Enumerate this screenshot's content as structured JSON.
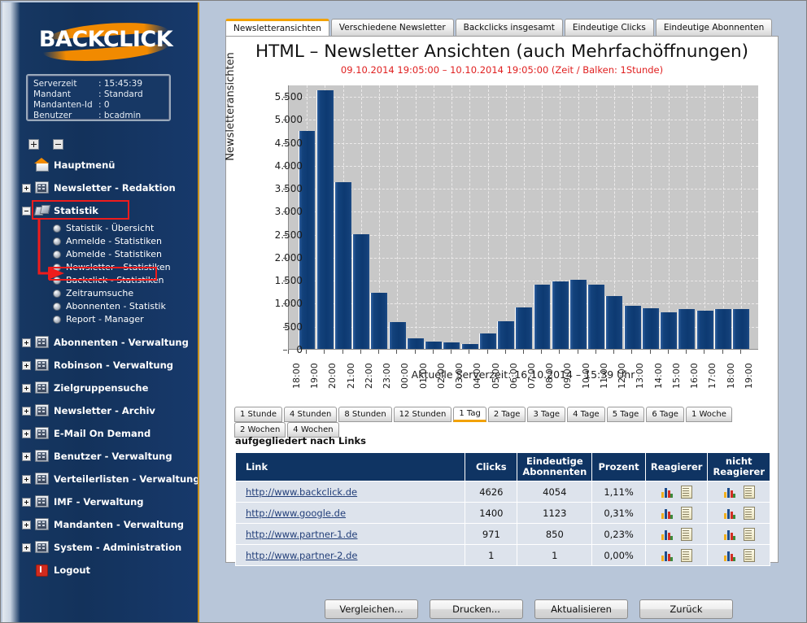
{
  "brand": {
    "name": "BACKCLICK"
  },
  "info": {
    "rows": [
      {
        "key": "Serverzeit",
        "sep": ": 15:45:39"
      },
      {
        "key": "Mandant",
        "sep": ": Standard"
      },
      {
        "key": "Mandanten-Id",
        "sep": ": 0"
      },
      {
        "key": "Benutzer",
        "sep": ": bcadmin"
      }
    ]
  },
  "tree_buttons": {
    "expand_all": "+",
    "collapse_all": "-"
  },
  "sidebar": {
    "items": [
      {
        "label": "Hauptmenü",
        "icon": "home-icon",
        "expandable": false
      },
      {
        "label": "Newsletter - Redaktion",
        "icon": "folder-icon",
        "expandable": true,
        "expanded": false
      },
      {
        "label": "Statistik",
        "icon": "statistics-icon",
        "expandable": true,
        "expanded": true,
        "highlighted": true
      },
      {
        "label": "Abonnenten - Verwaltung",
        "icon": "folder-icon",
        "expandable": true,
        "expanded": false
      },
      {
        "label": "Robinson - Verwaltung",
        "icon": "folder-icon",
        "expandable": true,
        "expanded": false
      },
      {
        "label": "Zielgruppensuche",
        "icon": "folder-icon",
        "expandable": true,
        "expanded": false
      },
      {
        "label": "Newsletter - Archiv",
        "icon": "folder-icon",
        "expandable": true,
        "expanded": false
      },
      {
        "label": "E-Mail On Demand",
        "icon": "folder-icon",
        "expandable": true,
        "expanded": false
      },
      {
        "label": "Benutzer - Verwaltung",
        "icon": "folder-icon",
        "expandable": true,
        "expanded": false
      },
      {
        "label": "Verteilerlisten - Verwaltung",
        "icon": "folder-icon",
        "expandable": true,
        "expanded": false
      },
      {
        "label": "IMF - Verwaltung",
        "icon": "folder-icon",
        "expandable": true,
        "expanded": false
      },
      {
        "label": "Mandanten - Verwaltung",
        "icon": "folder-icon",
        "expandable": true,
        "expanded": false
      },
      {
        "label": "System - Administration",
        "icon": "folder-icon",
        "expandable": true,
        "expanded": false
      },
      {
        "label": "Logout",
        "icon": "logout-icon",
        "expandable": false
      }
    ],
    "statistik_children": [
      "Statistik - Übersicht",
      "Anmelde - Statistiken",
      "Abmelde - Statistiken",
      "Newsletter - Statistiken",
      "Backclick - Statistiken",
      "Zeitraumsuche",
      "Abonnenten - Statistik",
      "Report - Manager"
    ],
    "selected_child": "Backclick - Statistiken"
  },
  "annotations": {
    "highlight_color": "#ee1c1c",
    "boxed_items": [
      "Statistik",
      "Backclick - Statistiken"
    ],
    "arrow": "points from Statistik node down to Backclick - Statistiken"
  },
  "tabs": [
    {
      "label": "Newsletteransichten",
      "active": true
    },
    {
      "label": "Verschiedene Newsletter",
      "active": false
    },
    {
      "label": "Backclicks insgesamt",
      "active": false
    },
    {
      "label": "Eindeutige Clicks",
      "active": false
    },
    {
      "label": "Eindeutige Abonnenten",
      "active": false
    }
  ],
  "chart_data": {
    "type": "bar",
    "title": "HTML – Newsletter Ansichten (auch Mehrfachöffnungen)",
    "subtitle": "09.10.2014 19:05:00 – 10.10.2014 19:05:00  (Zeit / Balken: 1Stunde)",
    "xlabel": "",
    "ylabel": "Newsletteransichten",
    "ylim": [
      0,
      5750
    ],
    "yticks": [
      0,
      500,
      1000,
      1500,
      2000,
      2500,
      3000,
      3500,
      4000,
      4500,
      5000,
      5500
    ],
    "ytick_labels": [
      "0",
      "500",
      "1.000",
      "1.500",
      "2.000",
      "2.500",
      "3.000",
      "3.500",
      "4.000",
      "4.500",
      "5.000",
      "5.500"
    ],
    "categories": [
      "18:00",
      "19:00",
      "20:00",
      "21:00",
      "22:00",
      "23:00",
      "00:00",
      "01:00",
      "02:00",
      "03:00",
      "04:00",
      "05:00",
      "06:00",
      "07:00",
      "08:00",
      "09:00",
      "10:00",
      "11:00",
      "12:00",
      "13:00",
      "14:00",
      "15:00",
      "16:00",
      "17:00",
      "18:00",
      "19:00"
    ],
    "bar_labels": [
      "19:00",
      "20:00",
      "21:00",
      "22:00",
      "23:00",
      "00:00",
      "01:00",
      "02:00",
      "03:00",
      "04:00",
      "05:00",
      "06:00",
      "07:00",
      "08:00",
      "09:00",
      "10:00",
      "11:00",
      "12:00",
      "13:00",
      "14:00",
      "15:00",
      "16:00",
      "17:00",
      "18:00",
      "19:00"
    ],
    "values": [
      4750,
      5620,
      3620,
      2500,
      1220,
      590,
      230,
      160,
      140,
      110,
      330,
      600,
      900,
      1400,
      1470,
      1500,
      1400,
      1150,
      930,
      890,
      800,
      860,
      840,
      870,
      870
    ],
    "grid": true,
    "legend": false,
    "bar_color": "#123f78",
    "plot_background": "#c8c8c8",
    "footer": "Aktuelle Serverzeit: 16.10.2014 – 15:39 Uhr"
  },
  "timerange": {
    "options": [
      "1 Stunde",
      "4 Stunden",
      "8 Stunden",
      "12 Stunden",
      "1 Tag",
      "2 Tage",
      "3 Tage",
      "4 Tage",
      "5 Tage",
      "6 Tage",
      "1 Woche",
      "2 Wochen",
      "4 Wochen"
    ],
    "selected": "1 Tag"
  },
  "table": {
    "caption": "aufgegliedert nach Links",
    "headers": [
      "Link",
      "Clicks",
      "Eindeutige Abonnenten",
      "Prozent",
      "Reagierer",
      "nicht Reagierer"
    ],
    "headers_split": {
      "eindeutige_abonnenten": [
        "Eindeutige",
        "Abonnenten"
      ],
      "nicht_reagierer": [
        "nicht",
        "Reagierer"
      ]
    },
    "rows": [
      {
        "link": "http://www.backclick.de",
        "clicks": "4626",
        "unique": "4054",
        "percent": "1,11%"
      },
      {
        "link": "http://www.google.de",
        "clicks": "1400",
        "unique": "1123",
        "percent": "0,31%"
      },
      {
        "link": "http://www.partner-1.de",
        "clicks": "971",
        "unique": "850",
        "percent": "0,23%"
      },
      {
        "link": "http://www.partner-2.de",
        "clicks": "1",
        "unique": "1",
        "percent": "0,00%"
      }
    ]
  },
  "actions": [
    {
      "label": "Vergleichen..."
    },
    {
      "label": "Drucken..."
    },
    {
      "label": "Aktualisieren"
    },
    {
      "label": "Zurück"
    }
  ]
}
